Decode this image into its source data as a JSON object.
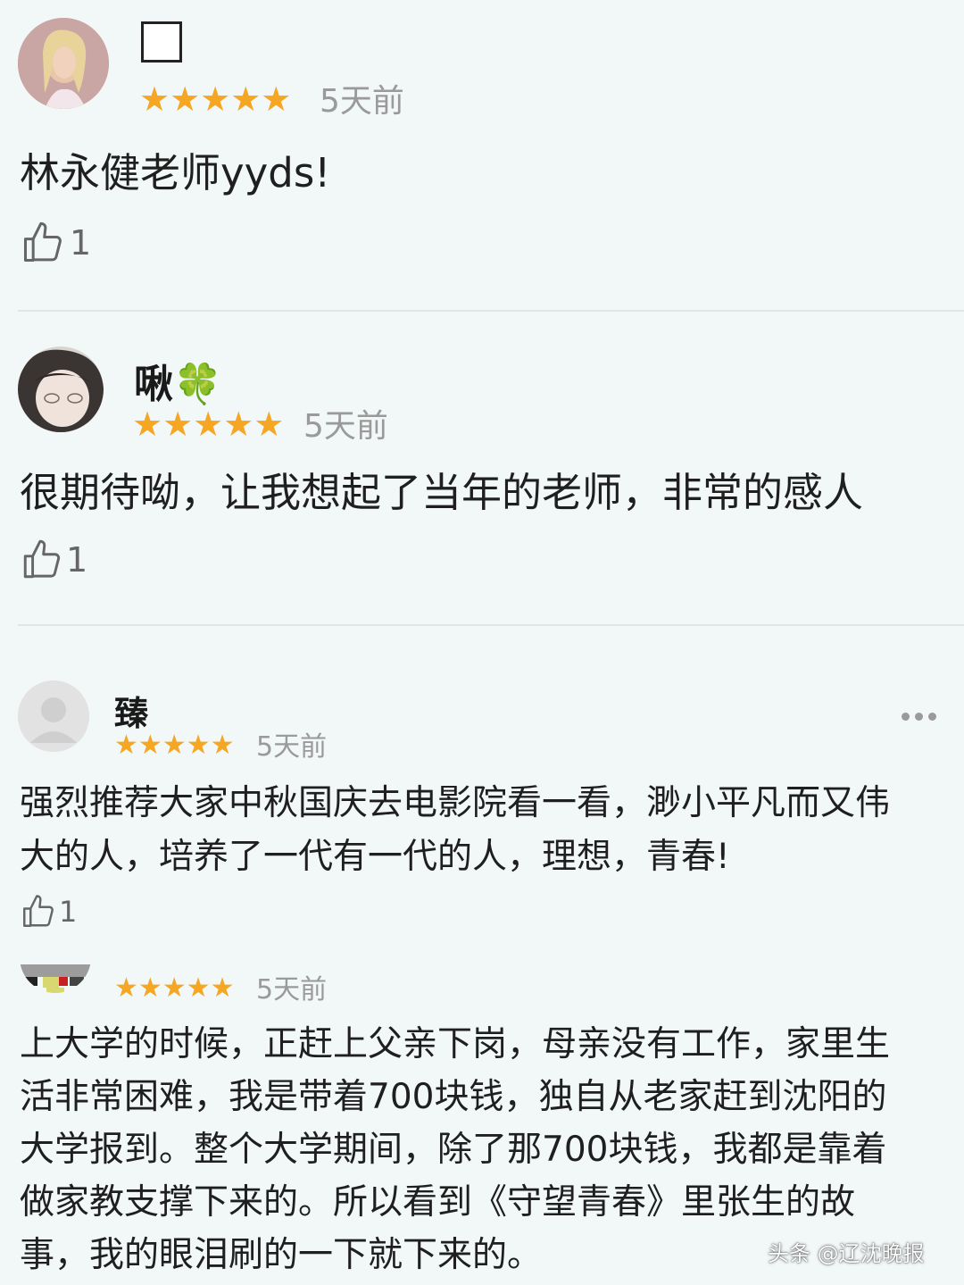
{
  "reviews": [
    {
      "username": "",
      "avatar": "blonde-woman-avatar",
      "stars": "★★★★★",
      "time": "5天前",
      "text": "林永健老师yyds!",
      "likes": "1"
    },
    {
      "username": "啾🍀",
      "avatar": "girl-avatar",
      "stars": "★★★★★",
      "time": "5天前",
      "text": "很期待呦，让我想起了当年的老师，非常的感人",
      "likes": "1"
    },
    {
      "username": "臻",
      "avatar": "default-user-avatar",
      "stars": "★★★★★",
      "time": "5天前",
      "text": "强烈推荐大家中秋国庆去电影院看一看，渺小平凡而又伟\n大的人，培养了一代有一代的人，理想，青春!",
      "likes": "1"
    },
    {
      "username": "",
      "avatar": "pixel-avatar",
      "stars": "★★★★★",
      "time": "5天前",
      "text": "上大学的时候，正赶上父亲下岗，母亲没有工作，家里生\n活非常困难，我是带着700块钱，独自从老家赶到沈阳的\n大学报到。整个大学期间，除了那700块钱，我都是靠着\n做家教支撑下来的。所以看到《守望青春》里张生的故\n事，我的眼泪刷的一下就下来的。"
    }
  ],
  "watermark": "头条 @辽沈晚报",
  "colors": {
    "background": "#f2f7f7",
    "star": "#f5a623",
    "time": "#9a9a9a"
  }
}
